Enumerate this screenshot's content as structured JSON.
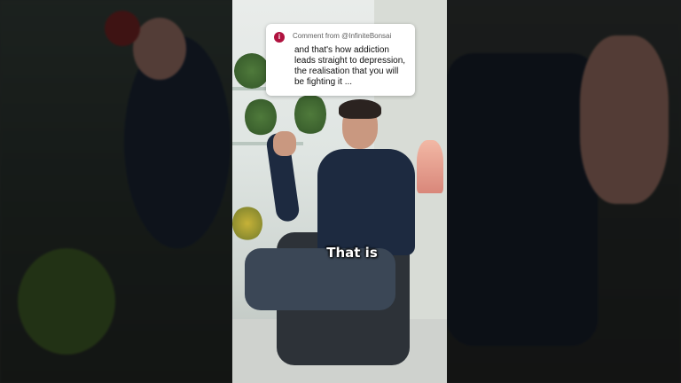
{
  "comment": {
    "avatar_initial": "i",
    "from_label": "Comment from @InfiniteBonsai",
    "text": "and that's how addiction leads straight to depression, the realisation that you will be fighting it ..."
  },
  "caption": {
    "text": "That is"
  },
  "colors": {
    "avatar": "#b0123f",
    "hoodie": "#1d2a40",
    "caption_text": "#ffffff"
  }
}
